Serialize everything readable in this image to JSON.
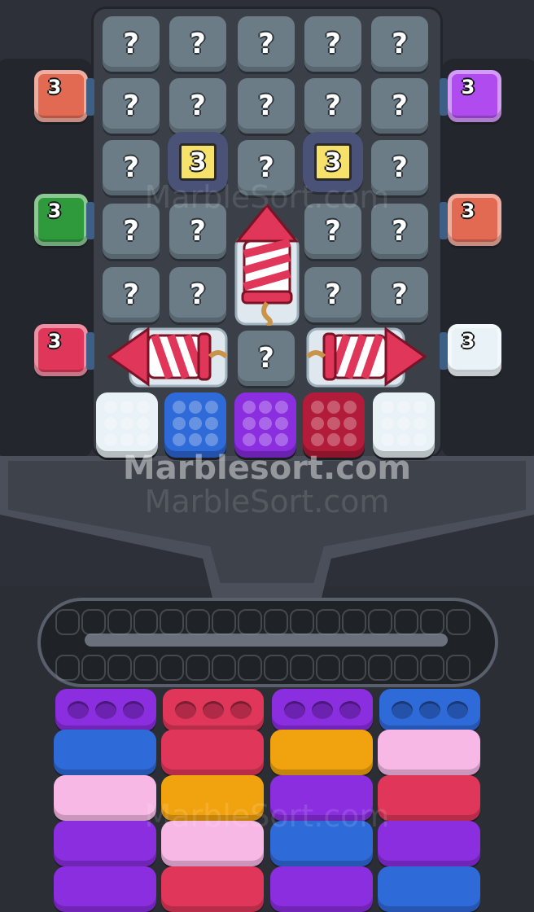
{
  "game": {
    "tile_mark": "?",
    "lock_count": "3",
    "side_count": "3"
  },
  "watermark": {
    "main": "Marblesort.com",
    "sub": "MarbleSort.com"
  },
  "colors": {
    "blue": "#2f6ad9",
    "purple": "#8a2ee0",
    "red": "#e0365a",
    "crimson": "#b31b3a",
    "white": "#e9f2f6",
    "green": "#2e9a3c",
    "orange": "#f1a30f",
    "pink": "#f7b8e6",
    "salmon": "#e26a52",
    "violet": "#b04bf0"
  },
  "left_blocks": [
    "salmon",
    "green",
    "red"
  ],
  "right_blocks": [
    "violet",
    "salmon",
    "white"
  ],
  "trays": [
    "white",
    "blue",
    "purple",
    "crimson",
    "white"
  ],
  "tubes": [
    {
      "top": "purple",
      "layers": [
        "blue",
        "pink",
        "purple",
        "purple"
      ]
    },
    {
      "top": "red",
      "layers": [
        "red",
        "orange",
        "pink",
        "red"
      ]
    },
    {
      "top": "purple",
      "layers": [
        "orange",
        "purple",
        "blue",
        "purple"
      ]
    },
    {
      "top": "blue",
      "layers": [
        "pink",
        "red",
        "purple",
        "blue"
      ]
    }
  ]
}
